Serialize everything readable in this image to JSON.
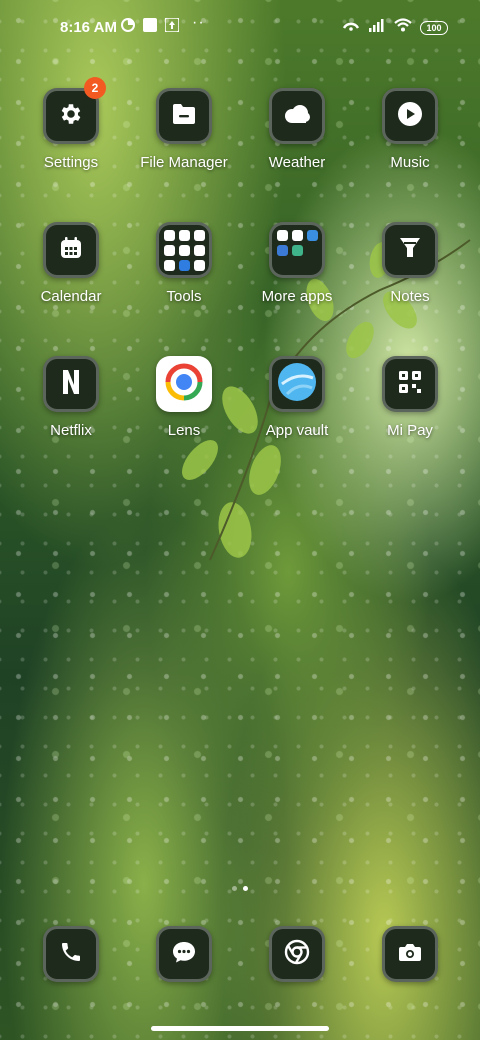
{
  "status_bar": {
    "time": "8:16 AM",
    "battery": "100"
  },
  "apps": [
    {
      "id": "settings",
      "label": "Settings",
      "icon": "gear-icon",
      "badge": "2"
    },
    {
      "id": "file-manager",
      "label": "File Manager",
      "icon": "folder-icon"
    },
    {
      "id": "weather",
      "label": "Weather",
      "icon": "cloud-icon"
    },
    {
      "id": "music",
      "label": "Music",
      "icon": "play-icon"
    },
    {
      "id": "calendar",
      "label": "Calendar",
      "icon": "calendar-icon"
    },
    {
      "id": "tools",
      "label": "Tools",
      "icon": "folder-grid-icon"
    },
    {
      "id": "more-apps",
      "label": "More apps",
      "icon": "folder-grid-icon"
    },
    {
      "id": "notes",
      "label": "Notes",
      "icon": "notes-icon"
    },
    {
      "id": "netflix",
      "label": "Netflix",
      "icon": "netflix-n-icon"
    },
    {
      "id": "lens",
      "label": "Lens",
      "icon": "lens-icon"
    },
    {
      "id": "app-vault",
      "label": "App vault",
      "icon": "app-vault-icon"
    },
    {
      "id": "mi-pay",
      "label": "Mi Pay",
      "icon": "mi-pay-icon"
    }
  ],
  "dock": [
    {
      "id": "phone",
      "icon": "phone-icon"
    },
    {
      "id": "messages",
      "icon": "message-icon"
    },
    {
      "id": "chrome",
      "icon": "chrome-icon"
    },
    {
      "id": "camera",
      "icon": "camera-icon"
    }
  ],
  "pages": {
    "count": 2,
    "current": 2
  },
  "colors": {
    "badge": "#f25a22",
    "tile": "#1e2a1c",
    "lens_blue": "#4285f4"
  }
}
